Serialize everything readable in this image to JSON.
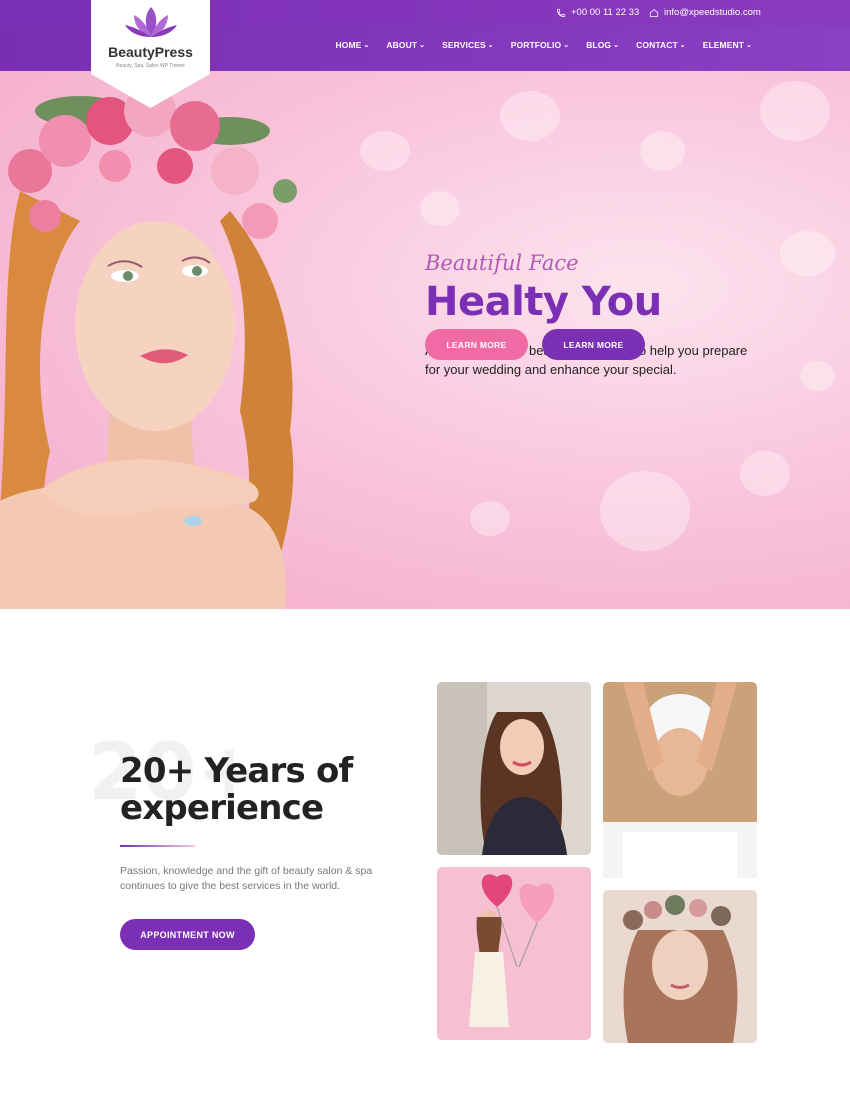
{
  "brand": {
    "name": "BeautyPress",
    "tagline": "Beauty, Spa, Salon WP Theme"
  },
  "topbar": {
    "phone": "+00 00 11 22 33",
    "email": "info@xpeedstudio.com"
  },
  "nav": [
    {
      "label": "HOME"
    },
    {
      "label": "ABOUT"
    },
    {
      "label": "SERVICES"
    },
    {
      "label": "PORTFOLIO"
    },
    {
      "label": "BLOG"
    },
    {
      "label": "CONTACT"
    },
    {
      "label": "ELEMENT"
    }
  ],
  "hero": {
    "script": "Beautiful Face",
    "title": "Healty You",
    "text": "Allow our team of beauty specialists to help you prepare for your wedding and enhance your special.",
    "button_primary": "LEARN MORE",
    "button_secondary": "LEARN MORE"
  },
  "about": {
    "ghost": "20+",
    "title": "20+ Years of experience",
    "text": "Passion, knowledge and the gift of beauty salon & spa continues to give the best services in the world.",
    "button": "APPOINTMENT NOW"
  },
  "colors": {
    "primary": "#7b2fb5",
    "pink": "#f06aa6",
    "hero_bg": "#f9c6dc"
  }
}
